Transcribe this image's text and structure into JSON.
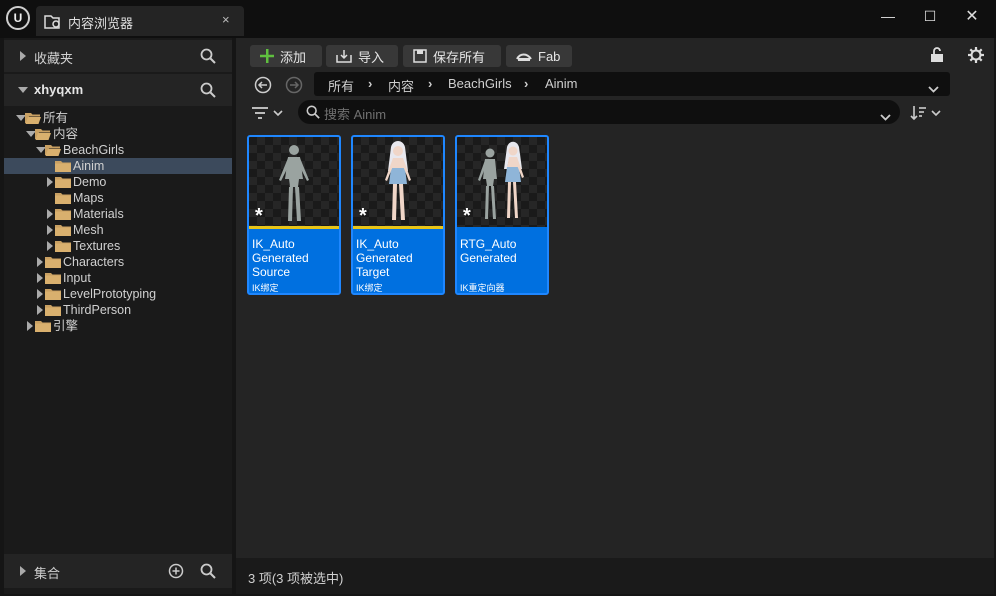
{
  "window": {
    "tab_title": "内容浏览器",
    "tab_close": "×",
    "minimize": "—",
    "maximize": "☐",
    "close": "✕"
  },
  "left_panel": {
    "favorites_label": "收藏夹",
    "project_label": "xhyqxm",
    "tree": [
      {
        "label": "所有",
        "depth": 0,
        "expanded": true,
        "selected": false
      },
      {
        "label": "内容",
        "depth": 1,
        "expanded": true,
        "selected": false
      },
      {
        "label": "BeachGirls",
        "depth": 2,
        "expanded": true,
        "selected": false
      },
      {
        "label": "Ainim",
        "depth": 3,
        "expanded": false,
        "selected": true,
        "leaf": true
      },
      {
        "label": "Demo",
        "depth": 3,
        "expanded": false,
        "selected": false
      },
      {
        "label": "Maps",
        "depth": 3,
        "expanded": false,
        "selected": false,
        "leaf": true
      },
      {
        "label": "Materials",
        "depth": 3,
        "expanded": false,
        "selected": false
      },
      {
        "label": "Mesh",
        "depth": 3,
        "expanded": false,
        "selected": false
      },
      {
        "label": "Textures",
        "depth": 3,
        "expanded": false,
        "selected": false
      },
      {
        "label": "Characters",
        "depth": 2,
        "expanded": false,
        "selected": false
      },
      {
        "label": "Input",
        "depth": 2,
        "expanded": false,
        "selected": false
      },
      {
        "label": "LevelPrototyping",
        "depth": 2,
        "expanded": false,
        "selected": false
      },
      {
        "label": "ThirdPerson",
        "depth": 2,
        "expanded": false,
        "selected": false
      },
      {
        "label": "引擎",
        "depth": 1,
        "expanded": false,
        "selected": false
      }
    ],
    "collections_label": "集合"
  },
  "toolbar": {
    "add_label": "添加",
    "import_label": "导入",
    "save_all_label": "保存所有",
    "fab_label": "Fab"
  },
  "breadcrumb": [
    "所有",
    "内容",
    "BeachGirls",
    "Ainim"
  ],
  "search": {
    "placeholder": "搜索 Ainim"
  },
  "assets": [
    {
      "name": "IK_Auto Generated Source",
      "type": "IK绑定",
      "figure": "mannequin"
    },
    {
      "name": "IK_Auto Generated Target",
      "type": "IK绑定",
      "figure": "girl"
    },
    {
      "name": "RTG_Auto Generated",
      "type": "IK重定向器",
      "figure": "both"
    }
  ],
  "status": "3 项(3 项被选中)",
  "colors": {
    "accent": "#0070e0",
    "thumb_underline": "#e8c417",
    "add_icon": "#5fbf3f"
  }
}
